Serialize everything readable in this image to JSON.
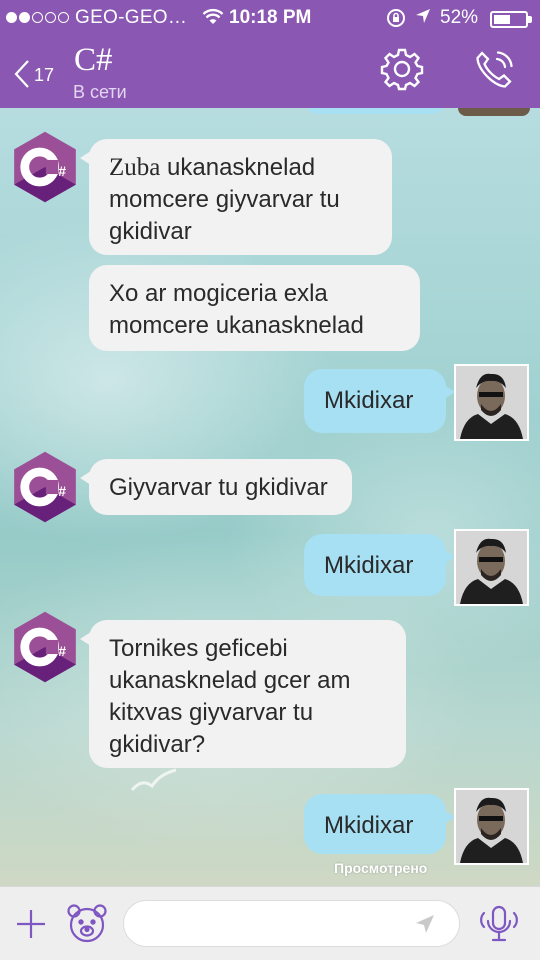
{
  "status_bar": {
    "carrier": "GEO-GEO…",
    "time": "10:18 PM",
    "battery": "52%",
    "battery_level": 0.52
  },
  "header": {
    "unread_count": "17",
    "title": "C#",
    "subtitle": "В сети"
  },
  "messages": [
    {
      "sender": "C#",
      "lead": "Zuba",
      "text": " ukanasknelad momcere giyvarvar tu gkidivar"
    },
    {
      "sender": "C#",
      "text": "Xo ar mogiceria exla momcere ukanasknelad"
    },
    {
      "sender": "me",
      "text": "Mkidixar"
    },
    {
      "sender": "C#",
      "text": "Giyvarvar tu gkidivar"
    },
    {
      "sender": "me",
      "text": "Mkidixar"
    },
    {
      "sender": "C#",
      "text": "Tornikes geficebi ukanasknelad gcer am kitxvas giyvarvar tu gkidivar?"
    },
    {
      "sender": "me",
      "text": "Mkidixar"
    }
  ],
  "seen_label": "Просмотрено",
  "composer": {
    "value": ""
  },
  "icons": {
    "back": "chevron-left-icon",
    "settings": "gear-icon",
    "call": "phone-icon",
    "attach": "plus-icon",
    "sticker": "bear-sticker-icon",
    "send": "send-arrow-icon",
    "voice": "microphone-icon"
  },
  "colors": {
    "header": "#8a58b3",
    "incoming_bubble": "#f2f2f2",
    "outgoing_bubble": "#a7dff3",
    "csharp_logo": "#9b4f96",
    "icon_purple": "#7e57c2"
  }
}
